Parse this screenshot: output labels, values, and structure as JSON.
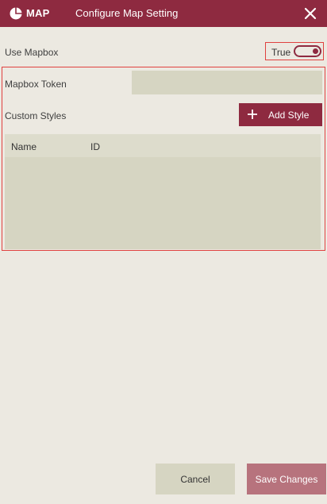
{
  "header": {
    "app_name": "MAP",
    "dialog_title": "Configure Map Setting",
    "logo_icon": "pie-chart-icon",
    "close_icon": "close-icon",
    "background_color": "#8e2a40"
  },
  "settings": {
    "use_mapbox_label": "Use Mapbox",
    "use_mapbox_value": "True",
    "use_mapbox_enabled": true,
    "mapbox_token_label": "Mapbox Token",
    "mapbox_token_value": "",
    "custom_styles_label": "Custom Styles",
    "add_style_label": "Add Style",
    "add_style_icon": "plus-icon"
  },
  "styles_table": {
    "columns": [
      "Name",
      "ID"
    ],
    "rows": []
  },
  "footer": {
    "cancel_label": "Cancel",
    "save_label": "Save Changes"
  },
  "colors": {
    "accent": "#8e2a40",
    "highlight_outline": "#e0413f",
    "field_background": "#d6d5c2",
    "page_background": "#ece9e1"
  }
}
